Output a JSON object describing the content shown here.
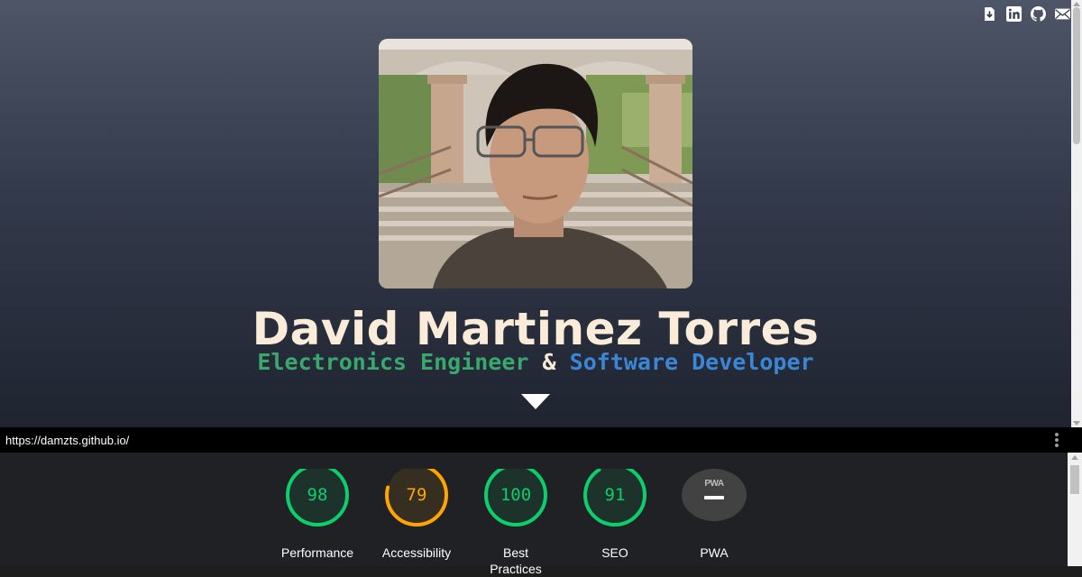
{
  "hero": {
    "name": "David Martinez Torres",
    "subtitle": {
      "part1": "Electronics Engineer",
      "amp": "&",
      "part2": "Software Developer"
    },
    "social_icons": [
      "download-icon",
      "linkedin-icon",
      "github-icon",
      "mail-icon"
    ],
    "colors": {
      "name": "#fbecd9",
      "engineer": "#3aa76d",
      "developer": "#3c86d6"
    }
  },
  "urlbar": {
    "url": "https://damzts.github.io/"
  },
  "lighthouse": {
    "gauges": [
      {
        "label": "Performance",
        "score": "98",
        "value": 98,
        "color": "#0cce6b"
      },
      {
        "label": "Accessibility",
        "score": "79",
        "value": 79,
        "color": "#ffa400"
      },
      {
        "label": "Best Practices",
        "score": "100",
        "value": 100,
        "color": "#0cce6b"
      },
      {
        "label": "SEO",
        "score": "91",
        "value": 91,
        "color": "#0cce6b"
      }
    ],
    "pwa": {
      "label": "PWA",
      "badge": "PWA"
    }
  }
}
